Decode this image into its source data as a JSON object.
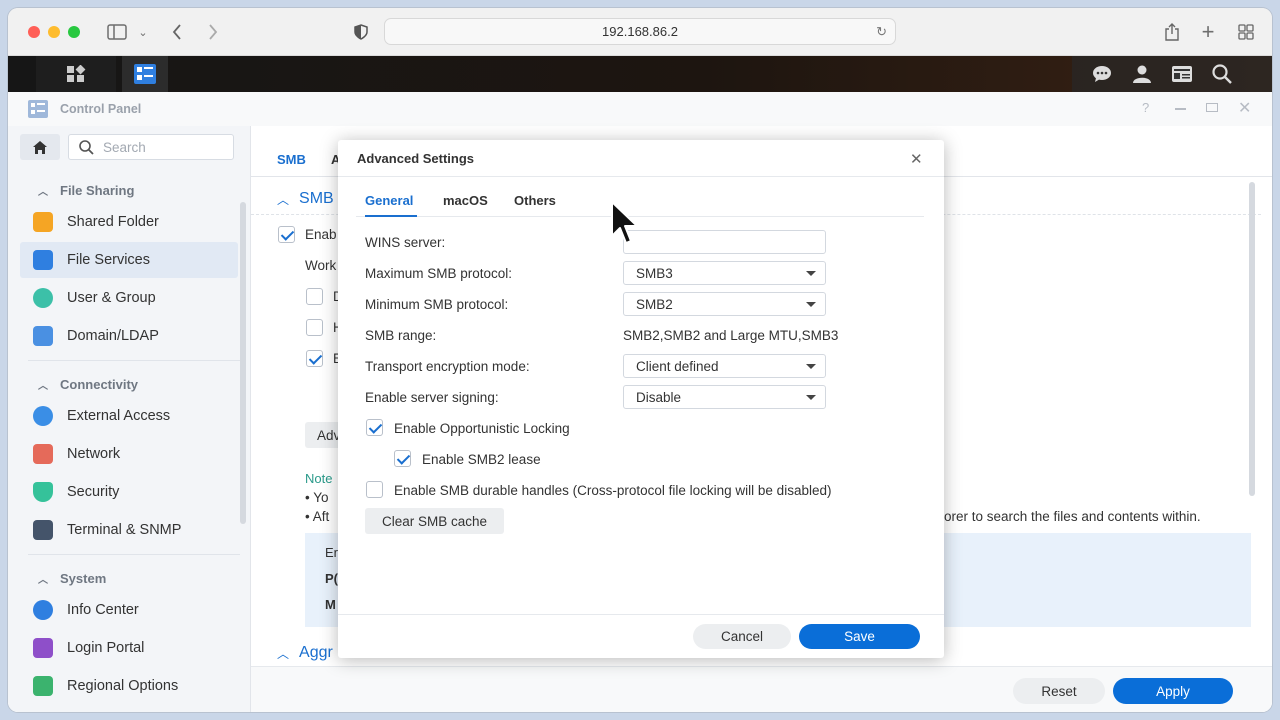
{
  "browser": {
    "url": "192.168.86.2"
  },
  "window": {
    "title": "Control Panel"
  },
  "sidebar": {
    "search_placeholder": "Search",
    "sections": [
      {
        "title": "File Sharing",
        "items": [
          "Shared Folder",
          "File Services",
          "User & Group",
          "Domain/LDAP"
        ]
      },
      {
        "title": "Connectivity",
        "items": [
          "External Access",
          "Network",
          "Security",
          "Terminal & SNMP"
        ]
      },
      {
        "title": "System",
        "items": [
          "Info Center",
          "Login Portal",
          "Regional Options"
        ]
      }
    ]
  },
  "main": {
    "tabs": [
      "SMB",
      "A"
    ],
    "section_smb": "SMB",
    "enable_label": "Enab",
    "workgroup_label": "Work",
    "cb_labels": [
      "D",
      "H",
      "E"
    ],
    "adv_button": "Adv",
    "note_label": "Note",
    "bullet1": "Yo",
    "bullet2": "Aft",
    "bullet2_tail": "orer to search the files and contents within.",
    "info_lines": [
      "Er",
      "P(",
      "M"
    ],
    "section_aggr": "Aggr",
    "reset_label": "Reset",
    "apply_label": "Apply"
  },
  "dialog": {
    "title": "Advanced Settings",
    "tabs": [
      "General",
      "macOS",
      "Others"
    ],
    "wins_label": "WINS server:",
    "wins_value": "",
    "max_label": "Maximum SMB protocol:",
    "max_value": "SMB3",
    "min_label": "Minimum SMB protocol:",
    "min_value": "SMB2",
    "range_label": "SMB range:",
    "range_value": "SMB2,SMB2 and Large MTU,SMB3",
    "encryption_label": "Transport encryption mode:",
    "encryption_value": "Client defined",
    "signing_label": "Enable server signing:",
    "signing_value": "Disable",
    "oplock_label": "Enable Opportunistic Locking",
    "oplock_checked": true,
    "smb2lease_label": "Enable SMB2 lease",
    "smb2lease_checked": true,
    "durable_label": "Enable SMB durable handles (Cross-protocol file locking will be disabled)",
    "durable_checked": false,
    "clear_cache_label": "Clear SMB cache",
    "cancel_label": "Cancel",
    "save_label": "Save"
  },
  "colors": {
    "accent": "#0a6ed8",
    "active_tab": "#1a6fcf"
  }
}
